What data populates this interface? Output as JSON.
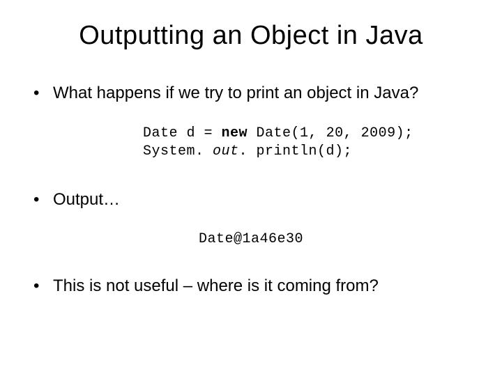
{
  "title": "Outputting an Object in Java",
  "bullets": {
    "b1": "What happens if we try to print an object in Java?",
    "b2": "Output…",
    "b3": "This is not useful – where is it coming from?"
  },
  "code": {
    "line1_pre": "Date d = ",
    "line1_keyword": "new",
    "line1_post": " Date(1, 20, 2009);",
    "line2_pre": "System. ",
    "line2_italic": "out",
    "line2_post": ". println(d);"
  },
  "output": "Date@1a46e30"
}
